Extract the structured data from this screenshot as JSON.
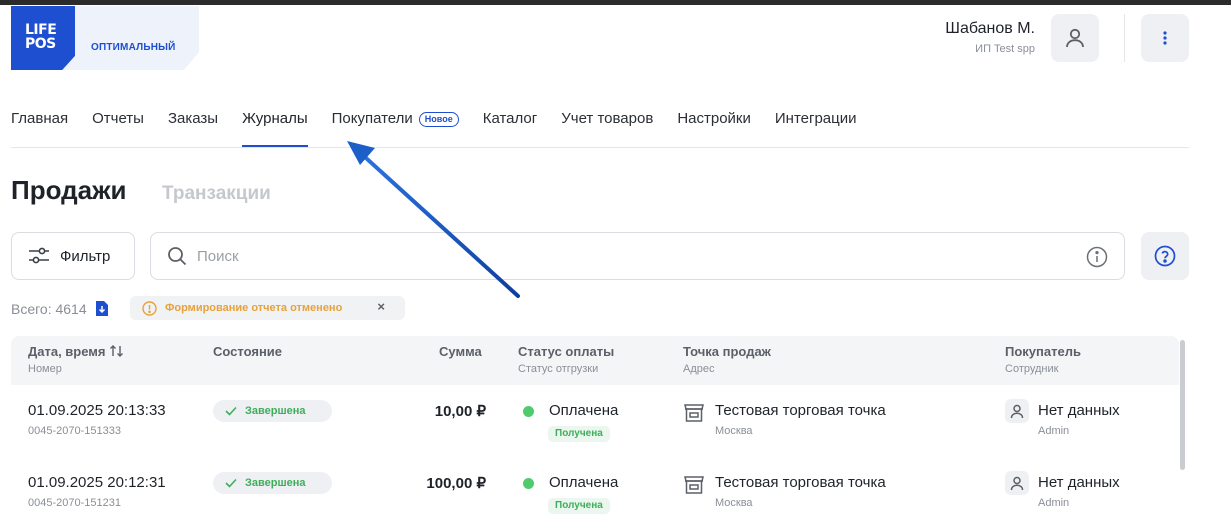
{
  "brand": {
    "logo_text": "LIFE POS",
    "logo_line1": "LIFE",
    "logo_line2": "POS",
    "plan": "ОПТИМАЛЬНЫЙ",
    "accent_color": "#1d4fd0"
  },
  "user": {
    "name": "Шабанов М.",
    "company": "ИП Test spp",
    "avatar_icon": "user-icon",
    "menu_icon": "more-vertical-icon"
  },
  "nav": {
    "items": [
      {
        "label": "Главная"
      },
      {
        "label": "Отчеты"
      },
      {
        "label": "Заказы"
      },
      {
        "label": "Журналы",
        "active": true
      },
      {
        "label": "Покупатели",
        "badge": "Новое"
      },
      {
        "label": "Каталог"
      },
      {
        "label": "Учет товаров"
      },
      {
        "label": "Настройки"
      },
      {
        "label": "Интеграции"
      }
    ]
  },
  "page": {
    "title": "Продажи",
    "subtab": "Транзакции"
  },
  "toolbar": {
    "filter_label": "Фильтр",
    "filter_icon": "sliders-icon",
    "search_placeholder": "Поиск",
    "search_icon": "search-icon",
    "info_icon": "info-icon",
    "help_icon": "help-circle-icon"
  },
  "summary": {
    "total_label": "Всего: 4614",
    "export_icon": "download-doc-icon",
    "report_status": "Формирование отчета отменено",
    "report_close": "×"
  },
  "table": {
    "columns": [
      {
        "title": "Дата, время",
        "subtitle": "Номер",
        "sort_icon": "sort-icon"
      },
      {
        "title": "Состояние",
        "subtitle": ""
      },
      {
        "title": "Сумма",
        "subtitle": ""
      },
      {
        "title": "Статус оплаты",
        "subtitle": "Статус отгрузки"
      },
      {
        "title": "Точка продаж",
        "subtitle": "Адрес"
      },
      {
        "title": "Покупатель",
        "subtitle": "Сотрудник"
      }
    ],
    "rows": [
      {
        "datetime": "01.09.2025 20:13:33",
        "number": "0045-2070-151333",
        "state": "Завершена",
        "sum": "10,00 ₽",
        "payment": "Оплачена",
        "shipment": "Получена",
        "store": "Тестовая торговая точка",
        "city": "Москва",
        "buyer": "Нет данных",
        "staff": "Admin"
      },
      {
        "datetime": "01.09.2025 20:12:31",
        "number": "0045-2070-151231",
        "state": "Завершена",
        "sum": "100,00 ₽",
        "payment": "Оплачена",
        "shipment": "Получена",
        "store": "Тестовая торговая точка",
        "city": "Москва",
        "buyer": "Нет данных",
        "staff": "Admin"
      }
    ]
  },
  "status_colors": {
    "success": "#3fae5b",
    "warning": "#e6a23c",
    "annotation_arrow": "#1d5fc9"
  }
}
